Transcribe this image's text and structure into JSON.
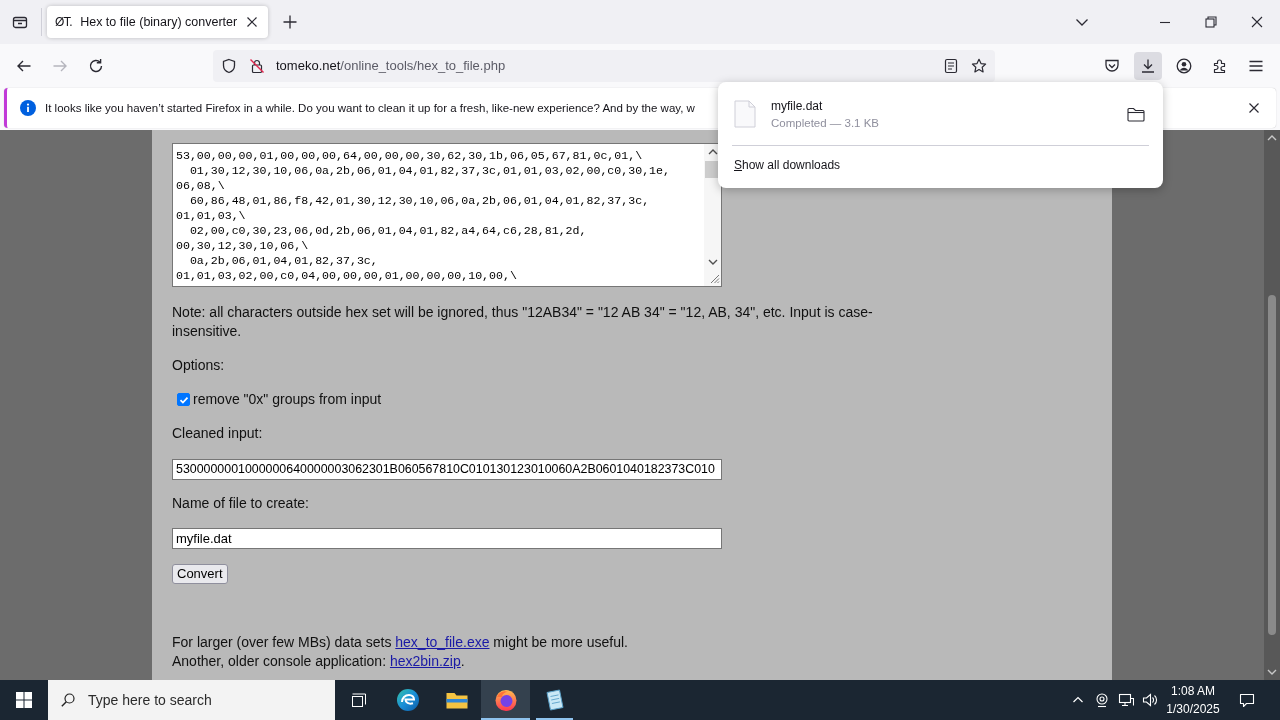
{
  "tab_bar": {
    "tabs": [
      {
        "favicon_text": "ØT.",
        "title": "Hex to file (binary) converter",
        "selected": true
      }
    ]
  },
  "nav_bar": {
    "back": {
      "disabled": false
    },
    "forward": {
      "disabled": true
    },
    "url": {
      "host": "tomeko.net",
      "path": "/online_tools/hex_to_file.php"
    },
    "downloads_button": {
      "pressed": true
    }
  },
  "notification": {
    "message": "It looks like you haven’t started Firefox in a while. Do you want to clean it up for a fresh, like-new experience? And by the way, w"
  },
  "downloads_panel": {
    "items": [
      {
        "name": "myfile.dat",
        "status": "Completed — 3.1 KB"
      }
    ],
    "footer": "Show all downloads"
  },
  "page": {
    "hex_input": {
      "lines": [
        "53,00,00,00,01,00,00,00,64,00,00,00,30,62,30,1b,06,05,67,81,0c,01,\\",
        "  01,30,12,30,10,06,0a,2b,06,01,04,01,82,37,3c,01,01,03,02,00,c0,30,1e,",
        "06,08,\\",
        "  60,86,48,01,86,f8,42,01,30,12,30,10,06,0a,2b,06,01,04,01,82,37,3c,",
        "01,01,03,\\",
        "  02,00,c0,30,23,06,0d,2b,06,01,04,01,82,a4,64,c6,28,81,2d,",
        "00,30,12,30,10,06,\\",
        "  0a,2b,06,01,04,01,82,37,3c,",
        "01,01,03,02,00,c0,04,00,00,00,01,00,00,00,10,00,\\"
      ]
    },
    "note": "Note: all characters outside hex set will be ignored, thus \"12AB34\" = \"12 AB 34\" = \"12, AB, 34\", etc. Input is case-insensitive.",
    "options_label": "Options:",
    "options": [
      {
        "label": "remove \"0x\" groups from input",
        "checked": true
      }
    ],
    "cleaned_input": {
      "label": "Cleaned input:",
      "value": "5300000001000000640000003062301B060567810C010130123010060A2B0601040182373C010"
    },
    "file_name": {
      "label": "Name of file to create:",
      "value": "myfile.dat"
    },
    "convert_button": "Convert",
    "footer": [
      [
        {
          "kind": "text",
          "text": "For larger (over few MBs) data sets "
        },
        {
          "kind": "link",
          "text": "hex_to_file.exe"
        },
        {
          "kind": "text",
          "text": " might be more useful."
        }
      ],
      [
        {
          "kind": "text",
          "text": "Another, older console application: "
        },
        {
          "kind": "link",
          "text": "hex2bin.zip"
        },
        {
          "kind": "text",
          "text": "."
        }
      ]
    ]
  },
  "taskbar": {
    "search_placeholder": "Type here to search",
    "apps": [
      {
        "kind": "edge",
        "running": false,
        "active": false
      },
      {
        "kind": "explorer",
        "running": false,
        "active": false
      },
      {
        "kind": "firefox",
        "running": true,
        "active": true
      },
      {
        "kind": "notepad",
        "running": true,
        "active": false
      }
    ],
    "clock": {
      "time": "1:08 AM",
      "date": "1/30/2025"
    }
  }
}
